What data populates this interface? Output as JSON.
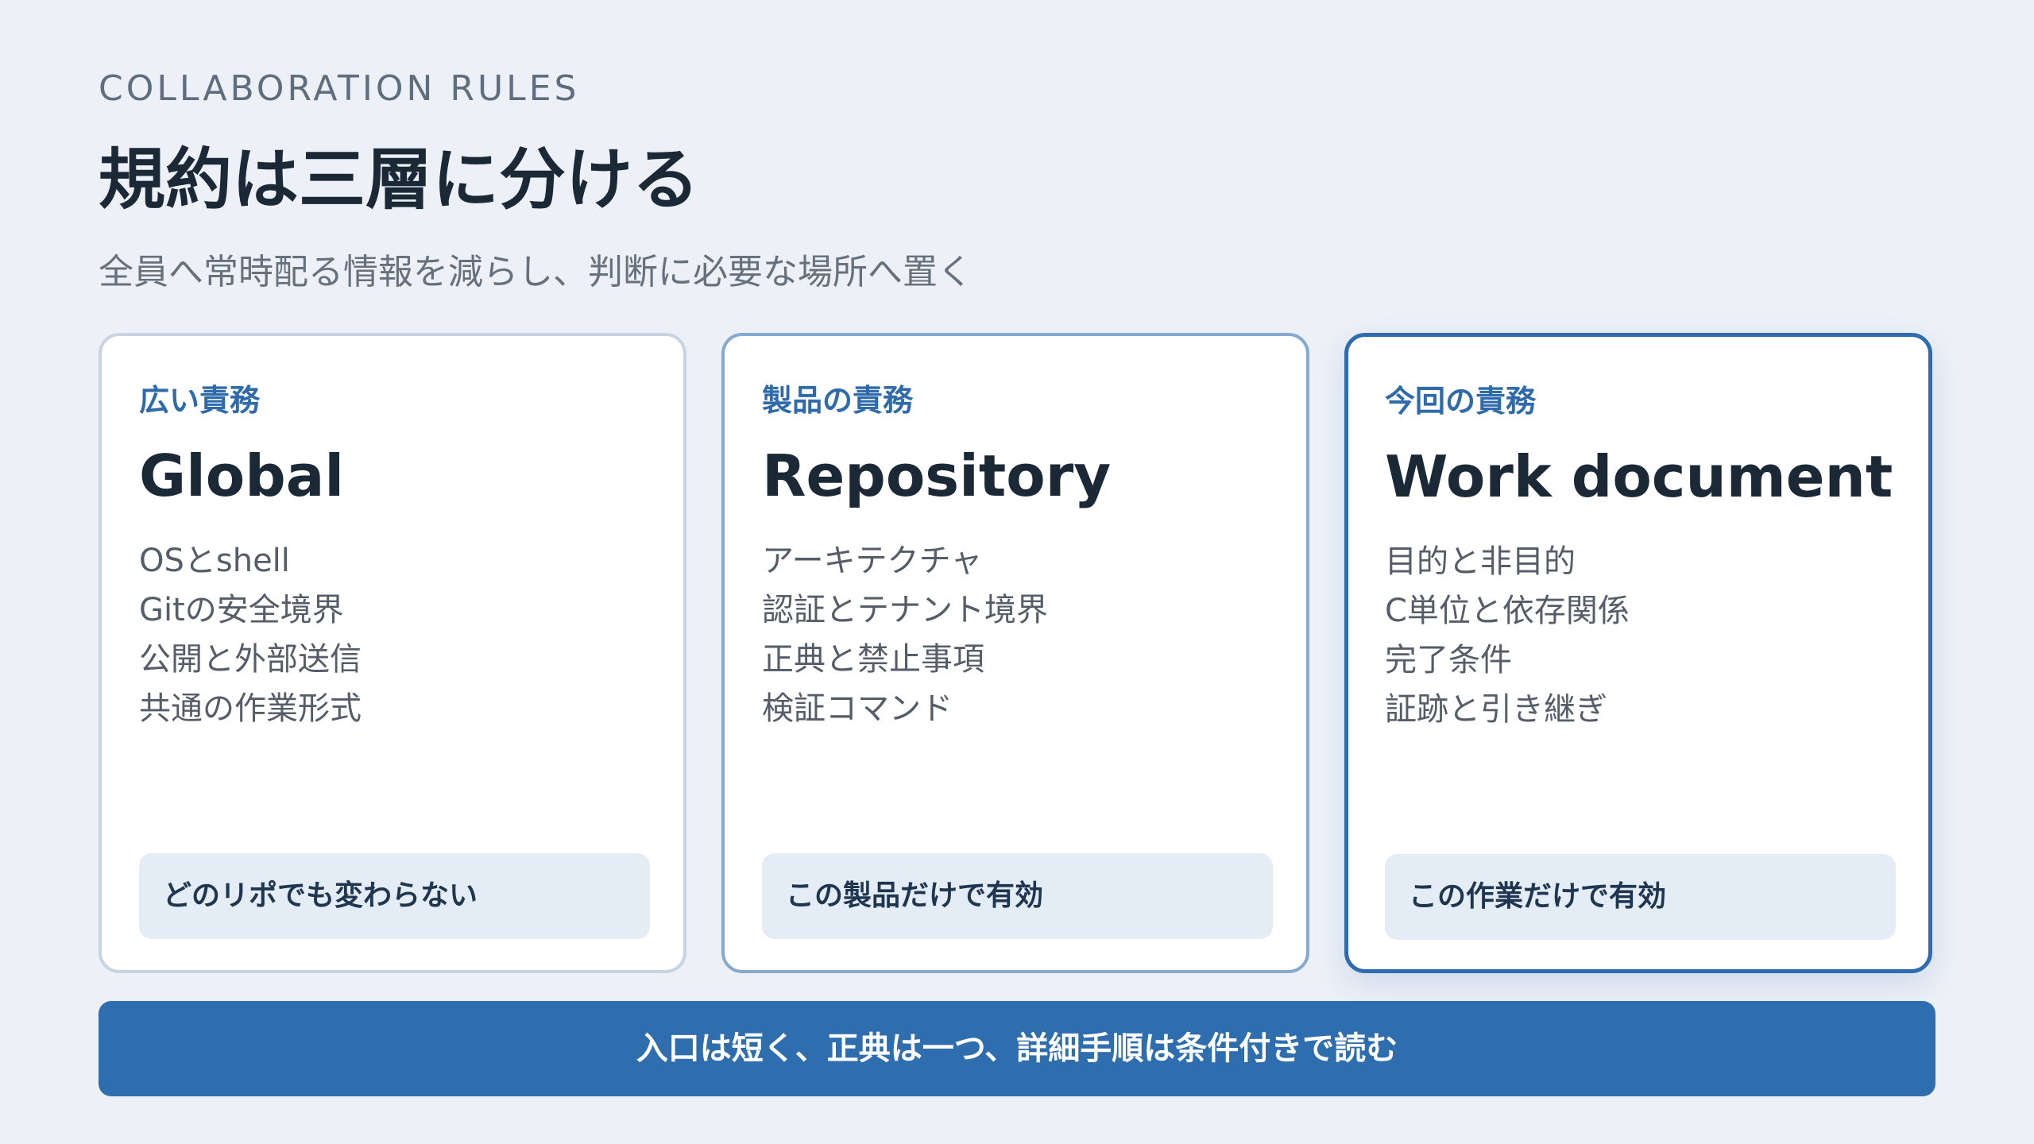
{
  "header": {
    "eyebrow": "COLLABORATION RULES",
    "title": "規約は三層に分ける",
    "subtitle": "全員へ常時配る情報を減らし、判断に必要な場所へ置く"
  },
  "cards": [
    {
      "kicker": "広い責務",
      "title": "Global",
      "items": [
        "OSとshell",
        "Gitの安全境界",
        "公開と外部送信",
        "共通の作業形式"
      ],
      "note": "どのリポでも変わらない"
    },
    {
      "kicker": "製品の責務",
      "title": "Repository",
      "items": [
        "アーキテクチャ",
        "認証とテナント境界",
        "正典と禁止事項",
        "検証コマンド"
      ],
      "note": "この製品だけで有効"
    },
    {
      "kicker": "今回の責務",
      "title": "Work document",
      "items": [
        "目的と非目的",
        "C単位と依存関係",
        "完了条件",
        "証跡と引き継ぎ"
      ],
      "note": "この作業だけで有効"
    }
  ],
  "banner": {
    "text": "入口は短く、正典は一つ、詳細手順は条件付きで読む"
  },
  "colors": {
    "background": "#edf1f7",
    "accent": "#2f6eae",
    "note_bg": "#e4ecf6"
  }
}
